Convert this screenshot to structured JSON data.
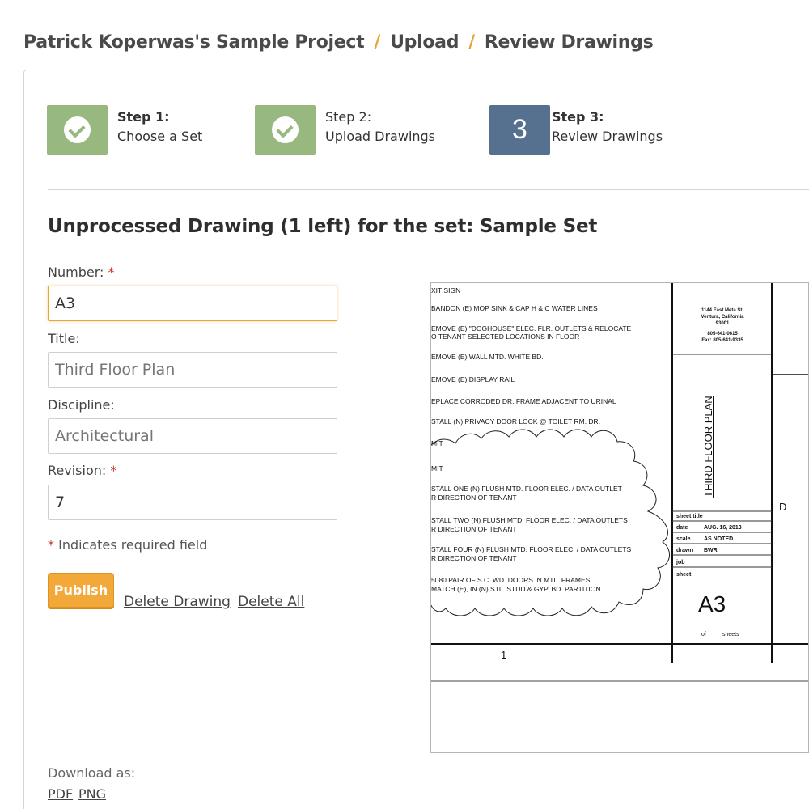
{
  "breadcrumb": {
    "project": "Patrick Koperwas's Sample Project",
    "separator": "/",
    "upload": "Upload",
    "current": "Review Drawings"
  },
  "steps": [
    {
      "title": "Step 1:",
      "subtitle": "Choose a Set",
      "status": "done"
    },
    {
      "title": "Step 2:",
      "subtitle": "Upload Drawings",
      "status": "done"
    },
    {
      "title": "Step 3:",
      "subtitle": "Review Drawings",
      "status": "current",
      "badge": "3"
    }
  ],
  "heading": "Unprocessed Drawing (1 left) for the set: Sample Set",
  "form": {
    "required_marker": "*",
    "number_label": "Number:",
    "number_value": "A3",
    "title_label": "Title:",
    "title_placeholder": "Third Floor Plan",
    "discipline_label": "Discipline:",
    "discipline_placeholder": "Architectural",
    "revision_label": "Revision:",
    "revision_value": "7",
    "required_note": "Indicates required field"
  },
  "actions": {
    "publish": "Publish",
    "delete_drawing": "Delete Drawing",
    "delete_all": "Delete All"
  },
  "download": {
    "label": "Download as:",
    "pdf": "PDF",
    "png": "PNG"
  },
  "drawing": {
    "notes": [
      "XIT SIGN",
      "BANDON (E) MOP SINK & CAP H & C WATER LINES",
      "EMOVE (E) \"DOGHOUSE\" ELEC. FLR. OUTLETS & RELOCATE",
      "O TENANT SELECTED LOCATIONS IN FLOOR",
      "EMOVE (E) WALL MTD. WHITE BD.",
      "EMOVE (E) DISPLAY RAIL",
      "EPLACE CORRODED DR. FRAME ADJACENT TO URINAL",
      "STALL (N) PRIVACY DOOR LOCK @ TOILET RM. DR.",
      "MIT",
      "MIT",
      "STALL ONE  (N) FLUSH MTD. FLOOR ELEC. / DATA OUTLET",
      "R DIRECTION OF TENANT",
      "STALL TWO  (N) FLUSH MTD. FLOOR ELEC. / DATA OUTLETS",
      "R DIRECTION OF TENANT",
      "STALL FOUR  (N) FLUSH MTD. FLOOR ELEC. / DATA OUTLETS",
      "R DIRECTION OF TENANT",
      "5080 PAIR OF S.C. WD. DOORS IN MTL. FRAMES,",
      "MATCH (E), IN (N) STL. STUD & GYP. BD. PARTITION"
    ],
    "address": [
      "1144 East Meta St.",
      "Ventura, California",
      "93001",
      "805-641-0615",
      "Fax: 805-641-9335"
    ],
    "sheet_title_vertical": "THIRD FLOOR PLAN",
    "sheet_title_label": "sheet title",
    "date_label": "date",
    "date_value": "AUG. 16, 2013",
    "scale_label": "scale",
    "scale_value": "AS NOTED",
    "drawn_label": "drawn",
    "drawn_value": "BWR",
    "job_label": "job",
    "sheet_label": "sheet",
    "sheet_number": "A3",
    "of_label": "of",
    "sheets_label": "sheets",
    "column_number": "1",
    "border_letter": "D"
  }
}
